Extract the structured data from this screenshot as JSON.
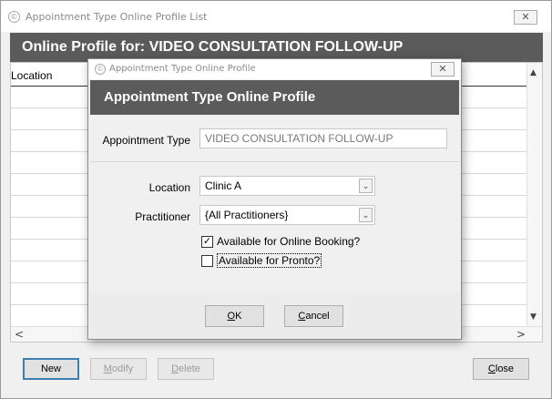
{
  "outer_window": {
    "title": "Appointment Type Online Profile List",
    "close_glyph": "✕",
    "header": "Online Profile for: VIDEO CONSULTATION FOLLOW-UP",
    "grid": {
      "column_header": "Location",
      "scroll_up": "▲",
      "scroll_down": "▼",
      "scroll_left": "<",
      "scroll_right": ">"
    },
    "buttons": {
      "new": "New",
      "modify_u": "M",
      "modify_rest": "odify",
      "delete_u": "D",
      "delete_rest": "elete",
      "close_u": "C",
      "close_rest": "lose"
    }
  },
  "dialog": {
    "title": "Appointment Type Online Profile",
    "close_glyph": "✕",
    "header": "Appointment Type Online Profile",
    "fields": {
      "appointment_type_label": "Appointment Type",
      "appointment_type_value": "VIDEO CONSULTATION FOLLOW-UP",
      "location_label": "Location",
      "location_value": "Clinic A",
      "practitioner_label": "Practitioner",
      "practitioner_value": "{All Practitioners}",
      "chevron_glyph": "⌄"
    },
    "checkboxes": {
      "online_booking_label": "Available for Online Booking?",
      "online_booking_checked": true,
      "online_booking_mark": "✓",
      "pronto_label": "Available for Pronto?",
      "pronto_checked": false
    },
    "buttons": {
      "ok_u": "O",
      "ok_rest": "K",
      "cancel_u": "C",
      "cancel_rest": "ancel"
    }
  },
  "colors": {
    "header_bg": "#5b5b5b",
    "header_text": "#ffffff",
    "window_bg": "#f0f0f0",
    "default_button_border": "#3c7fb1"
  },
  "icons": [
    "app-icon",
    "close-icon",
    "chevron-down-icon",
    "scroll-up-icon",
    "scroll-down-icon",
    "scroll-left-icon",
    "scroll-right-icon",
    "checkmark-icon"
  ]
}
